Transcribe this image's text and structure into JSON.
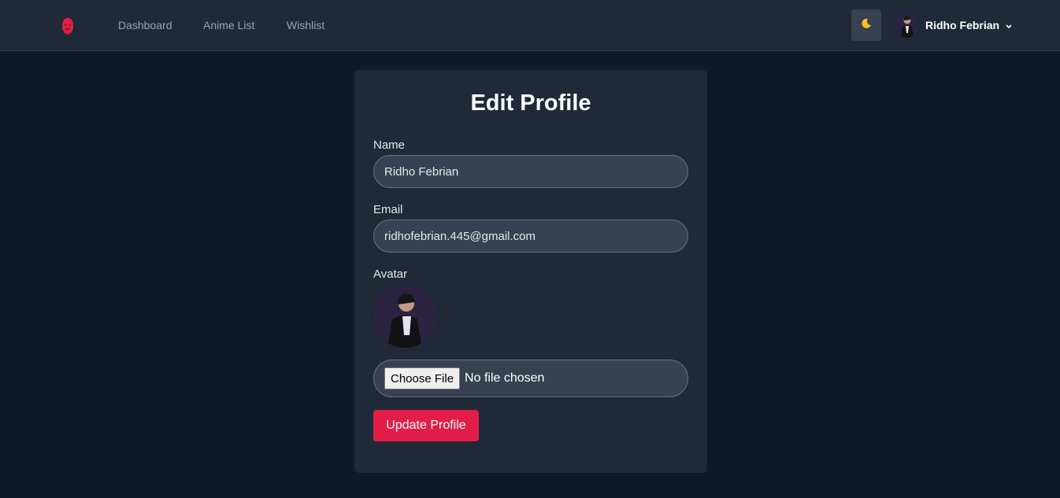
{
  "navbar": {
    "logo_icon": "demon-mask-logo",
    "links": [
      {
        "label": "Dashboard"
      },
      {
        "label": "Anime List"
      },
      {
        "label": "Wishlist"
      }
    ],
    "theme_toggle_icon": "moon-icon",
    "user": {
      "name": "Ridho Febrian",
      "avatar_icon": "user-avatar",
      "menu_icon": "chevron-down-icon"
    }
  },
  "form": {
    "title": "Edit Profile",
    "name_label": "Name",
    "name_value": "Ridho Febrian",
    "email_label": "Email",
    "email_value": "ridhofebrian.445@gmail.com",
    "avatar_label": "Avatar",
    "file_button": "Choose File",
    "file_status": "No file chosen",
    "submit_label": "Update Profile"
  },
  "colors": {
    "page_background": "#111827",
    "navbar_background": "#1f2937",
    "card_background": "#1f2937",
    "input_background": "#374151",
    "accent": "#e11d48"
  }
}
